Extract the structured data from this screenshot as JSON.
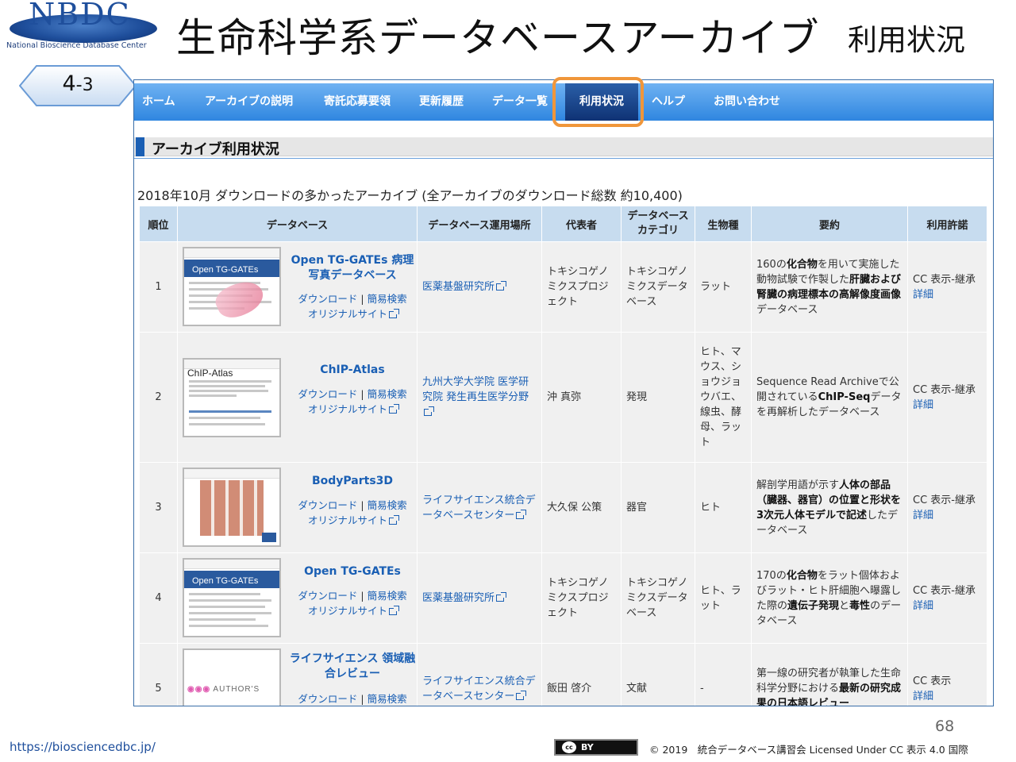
{
  "logo": {
    "text": "NBDC",
    "subtext": "National Bioscience Database Center"
  },
  "slide": {
    "title": "生命科学系データベースアーカイブ",
    "subtitle": "利用状況",
    "badge_main": "4",
    "badge_sub": "-3",
    "page_number": "68",
    "url": "https://biosciencedbc.jp/",
    "cc_label": "BY",
    "cc_icon": "cc",
    "copyright": "© 2019　統合データベース講習会 Licensed Under CC 表示 4.0 国際"
  },
  "nav": {
    "items": [
      "ホーム",
      "アーカイブの説明",
      "寄託応募要領",
      "更新履歴",
      "データ一覧",
      "利用状況",
      "ヘルプ",
      "お問い合わせ"
    ],
    "active": "利用状況"
  },
  "section": {
    "title": "アーカイブ利用状況"
  },
  "caption": "2018年10月 ダウンロードの多かったアーカイブ (全アーカイブのダウンロード総数 約10,400)",
  "table": {
    "headers": [
      "順位",
      "データベース",
      "データベース運用場所",
      "代表者",
      "データベース\nカテゴリ",
      "生物種",
      "要約",
      "利用許諾"
    ],
    "link_download": "ダウンロード",
    "link_search": "簡易検索",
    "link_original": "オリジナルサイト",
    "detail": "詳細",
    "rows": [
      {
        "rank": "1",
        "db": "Open TG-GATEs 病理写真データベース",
        "thumb": "Open TG-GATEs",
        "location": "医薬基盤研究所",
        "rep": "トキシコゲノミクスプロジェクト",
        "category": "トキシコゲノミクスデータベース",
        "species": "ラット",
        "summary_a": "160の",
        "summary_b": "化合物",
        "summary_c": "を用いて実施した動物試験で作製した",
        "summary_d": "肝臓および腎臓の病理標本の高解像度画像",
        "summary_e": "データベース",
        "license": "CC 表示-継承"
      },
      {
        "rank": "2",
        "db": "ChIP-Atlas",
        "thumb": "ChIP-Atlas",
        "location": "九州大学大学院 医学研究院 発生再生医学分野",
        "rep": "沖 真弥",
        "category": "発現",
        "species": "ヒト、マウス、ショウジョウバエ、線虫、酵母、ラット",
        "summary_a": "Sequence Read Archiveで公開されている",
        "summary_b": "ChIP-Seq",
        "summary_c": "データを再解析したデータベース",
        "license": "CC 表示-継承"
      },
      {
        "rank": "3",
        "db": "BodyParts3D",
        "location": "ライフサイエンス統合データベースセンター",
        "rep": "大久保 公策",
        "category": "器官",
        "species": "ヒト",
        "summary_a": "解剖学用語が示す",
        "summary_b": "人体の部品（臓器、器官）の位置と形状を3次元人体モデルで記述",
        "summary_c": "したデータベース",
        "license": "CC 表示-継承"
      },
      {
        "rank": "4",
        "db": "Open TG-GATEs",
        "thumb": "Open TG-GATEs",
        "location": "医薬基盤研究所",
        "rep": "トキシコゲノミクスプロジェクト",
        "category": "トキシコゲノミクスデータベース",
        "species": "ヒト、ラット",
        "summary_a": "170の",
        "summary_b": "化合物",
        "summary_c": "をラット個体およびラット・ヒト肝細胞へ曝露した際の",
        "summary_d": "遺伝子発現",
        "summary_e": "と",
        "summary_f": "毒性",
        "summary_g": "のデータベース",
        "license": "CC 表示-継承"
      },
      {
        "rank": "5",
        "db": "ライフサイエンス 領域融合レビュー",
        "thumb": "AUTHOR'S",
        "location": "ライフサイエンス統合データベースセンター",
        "rep": "飯田 啓介",
        "category": "文献",
        "species": "-",
        "summary_a": "第一線の研究者が執筆した生命科学分野における",
        "summary_b": "最新の研究成果の日本語レビュー",
        "license": "CC 表示"
      }
    ]
  },
  "colors": {
    "nav_gradient_top": "#6fb2f2",
    "nav_gradient_bottom": "#2f86e0",
    "nav_active": "#0f3274",
    "highlight": "#f0963a",
    "link": "#1a5fb4",
    "header_cell": "#c7dcef"
  }
}
